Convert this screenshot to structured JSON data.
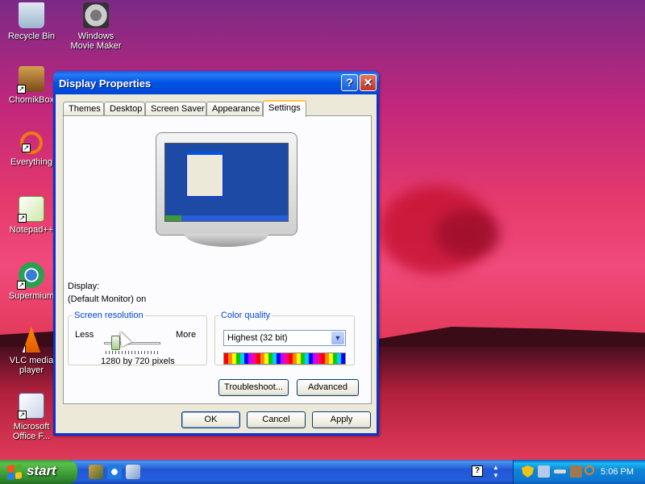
{
  "desktop": {
    "icons": [
      {
        "label": "Recycle Bin",
        "icon": "recycle-bin-icon"
      },
      {
        "label": "Windows Movie Maker",
        "icon": "movie-maker-icon"
      },
      {
        "label": "ChomikBox",
        "icon": "chomikbox-icon"
      },
      {
        "label": "Everything",
        "icon": "everything-icon"
      },
      {
        "label": "Notepad++",
        "icon": "notepad-plus-plus-icon"
      },
      {
        "label": "Supermium",
        "icon": "supermium-icon"
      },
      {
        "label": "VLC media player",
        "icon": "vlc-icon"
      },
      {
        "label": "Microsoft Office F...",
        "icon": "office-icon"
      }
    ]
  },
  "dialog": {
    "title": "Display Properties",
    "help_symbol": "?",
    "close_symbol": "✕",
    "tabs": [
      {
        "label": "Themes",
        "active": false
      },
      {
        "label": "Desktop",
        "active": false
      },
      {
        "label": "Screen Saver",
        "active": false
      },
      {
        "label": "Appearance",
        "active": false
      },
      {
        "label": "Settings",
        "active": true
      }
    ],
    "display_label": "Display:",
    "display_value": "(Default Monitor) on",
    "resolution": {
      "legend": "Screen resolution",
      "less": "Less",
      "more": "More",
      "value": "1280 by 720 pixels",
      "slider_position": 0.25
    },
    "color_quality": {
      "legend": "Color quality",
      "selected": "Highest (32 bit)"
    },
    "troubleshoot_label": "Troubleshoot...",
    "advanced_label": "Advanced",
    "ok_label": "OK",
    "cancel_label": "Cancel",
    "apply_label": "Apply"
  },
  "taskbar": {
    "start_label": "start",
    "clock": "5:06 PM"
  },
  "colors": {
    "title_blue": "#0054e3",
    "start_green": "#3c9a3a",
    "legend_blue": "#0046d5"
  }
}
